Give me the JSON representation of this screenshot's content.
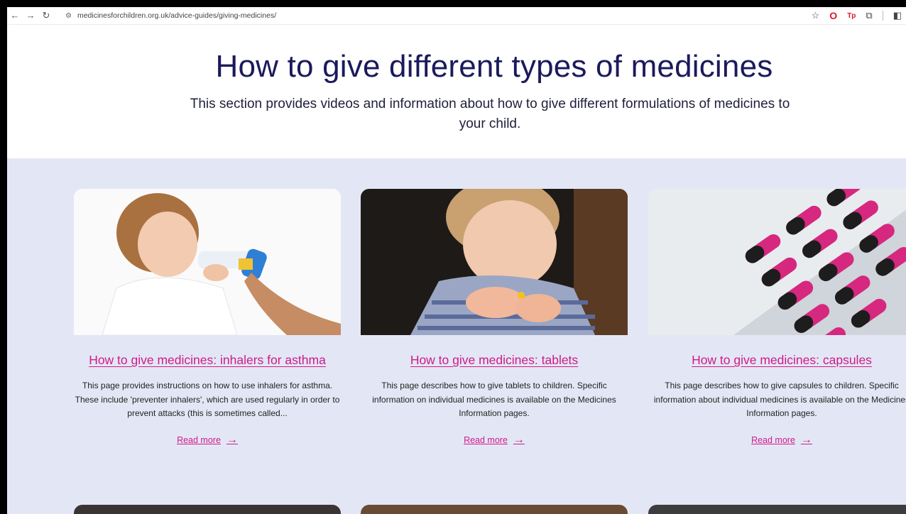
{
  "browser": {
    "url": "medicinesforchildren.org.uk/advice-guides/giving-medicines/"
  },
  "hero": {
    "title": "How to give different types of medicines",
    "subtitle": "This section provides videos and information about how to give different formulations of medicines to your child."
  },
  "cards": [
    {
      "title": "How to give medicines: inhalers for asthma",
      "description": "This page provides instructions on how to use inhalers for asthma. These include 'preventer inhalers', which are used regularly in order to prevent attacks (this is sometimes called...",
      "read_more": "Read more"
    },
    {
      "title": "How to give medicines: tablets",
      "description": "This page describes how to give tablets to children. Specific information on individual medicines is available on the Medicines Information pages.",
      "read_more": "Read more"
    },
    {
      "title": "How to give medicines: capsules",
      "description": "This page describes how to give capsules to children. Specific information about individual medicines is available on the Medicines Information pages.",
      "read_more": "Read more"
    }
  ],
  "colors": {
    "title": "#1b1a5c",
    "link": "#d0198a",
    "section_bg": "#e3e7f5"
  }
}
